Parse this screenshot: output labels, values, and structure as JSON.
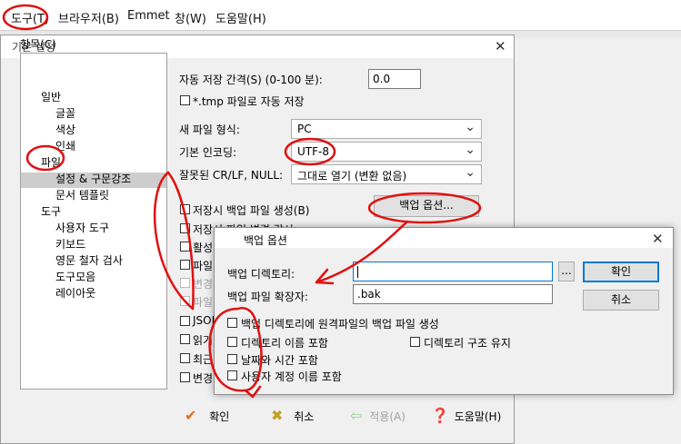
{
  "menubar": {
    "items": [
      "도구(T)",
      "브라우저(B)",
      "Emmet",
      "창(W)",
      "도움말(H)"
    ]
  },
  "dialog": {
    "title": "기본 설정",
    "tree_label": "항목(C)",
    "tree": [
      {
        "label": "일반",
        "level": 1
      },
      {
        "label": "글꼴",
        "level": 2
      },
      {
        "label": "색상",
        "level": 2
      },
      {
        "label": "인쇄",
        "level": 2
      },
      {
        "label": "파일",
        "level": 1,
        "selected": true
      },
      {
        "label": "설정 & 구문강조",
        "level": 2
      },
      {
        "label": "문서 템플릿",
        "level": 2
      },
      {
        "label": "도구",
        "level": 1
      },
      {
        "label": "사용자 도구",
        "level": 2
      },
      {
        "label": "키보드",
        "level": 2
      },
      {
        "label": "영문 철자 검사",
        "level": 2
      },
      {
        "label": "도구모음",
        "level": 2
      },
      {
        "label": "레이아웃",
        "level": 2
      }
    ],
    "autosave_label": "자동 저장 간격(S) (0-100 분):",
    "autosave_value": "0.0",
    "tmp_autosave_label": "*.tmp 파일로 자동 저장",
    "newfile_label": "새 파일 형식:",
    "newfile_value": "PC",
    "encoding_label": "기본 인코딩:",
    "encoding_value": "UTF-8",
    "crlf_label": "잘못된 CR/LF, NULL:",
    "crlf_value": "그대로 열기 (변환 없음)",
    "backup_create_label": "저장시 백업 파일 생성(B)",
    "backup_options_button": "백업 옵션...",
    "hidden_rows": [
      "저장시 파일 변경 감시",
      "활성",
      "파일",
      "변경",
      "파일",
      "JSON",
      "읽기",
      "최근",
      "변경"
    ],
    "buttons": {
      "ok": "확인",
      "cancel": "취소",
      "apply": "적용(A)",
      "help": "도움말(H)"
    }
  },
  "backup_dialog": {
    "title": "백업 옵션",
    "backup_dir_label": "백업 디렉토리:",
    "backup_dir_value": "",
    "browse_button": "...",
    "ext_label": "백업 파일 확장자:",
    "ext_value": ".bak",
    "ok_button": "확인",
    "cancel_button": "취소",
    "checkboxes": [
      "백업 디렉토리에 원격파일의 백업 파일 생성",
      "디렉토리 이름 포함",
      "날짜와 시간 포함",
      "사용자 계정 이름 포함"
    ],
    "keep_structure_label": "디렉토리 구조 유지"
  },
  "colors": {
    "annotation_red": "#e01010",
    "selection_gray": "#cdcdcd",
    "focus_blue": "#0078d7",
    "ok_check_orange": "#e86a1a",
    "cancel_x_gold": "#c8a021",
    "help_blue": "#2a6fc9"
  },
  "icons": {
    "ok": "check-icon",
    "cancel": "x-icon",
    "apply": "back-arrow-icon",
    "help": "help-book-icon",
    "close": "close-icon",
    "dropdown": "chevron-down-icon"
  }
}
